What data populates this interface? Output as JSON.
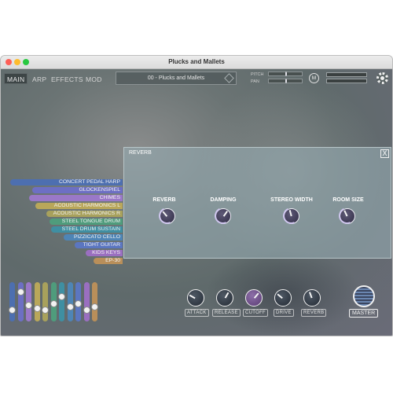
{
  "window": {
    "title": "Plucks and Mallets"
  },
  "tabs": [
    {
      "label": "MAIN",
      "active": true
    },
    {
      "label": "ARP",
      "active": false
    },
    {
      "label": "EFFECTS",
      "active": false
    },
    {
      "label": "MOD",
      "active": false
    }
  ],
  "preset": {
    "name": "00 - Plucks and Mallets"
  },
  "controls": {
    "pitch_label": "PITCH",
    "pan_label": "PAN",
    "m_button": "M"
  },
  "instruments": [
    {
      "name": "CONCERT PEDAL HARP",
      "color": "#4d6fb0"
    },
    {
      "name": "GLOCKENSPIEL",
      "color": "#6d6fc4"
    },
    {
      "name": "CHIMES",
      "color": "#9a78c8"
    },
    {
      "name": "ACOUSTIC HARMONICS L",
      "color": "#b9a75a"
    },
    {
      "name": "ACOUSTIC HARMONICS R",
      "color": "#a8a15c"
    },
    {
      "name": "STEEL TONGUE DRUM",
      "color": "#4f9c7c"
    },
    {
      "name": "STEEL DRUM SUSTAIN",
      "color": "#3f8fa2"
    },
    {
      "name": "PIZZICATO CELLO",
      "color": "#4e85b6"
    },
    {
      "name": "TIGHT GUITAR",
      "color": "#5b76c0"
    },
    {
      "name": "KIDS KEYS",
      "color": "#9a6fc0"
    },
    {
      "name": "EP-30",
      "color": "#b98f5a"
    }
  ],
  "mixer_levels": [
    0.25,
    0.8,
    0.4,
    0.3,
    0.25,
    0.45,
    0.65,
    0.35,
    0.45,
    0.25,
    0.35
  ],
  "reverb": {
    "title": "REVERB",
    "close_label": "X",
    "knobs": [
      {
        "label": "REVERB"
      },
      {
        "label": "DAMPING"
      },
      {
        "label": "STEREO WIDTH"
      },
      {
        "label": "ROOM SIZE"
      }
    ]
  },
  "bottom_knobs": [
    {
      "label": "ATTACK"
    },
    {
      "label": "RELEASE"
    },
    {
      "label": "CUTOFF"
    },
    {
      "label": "DRIVE"
    },
    {
      "label": "REVERB"
    }
  ],
  "master": {
    "label": "MASTER"
  }
}
